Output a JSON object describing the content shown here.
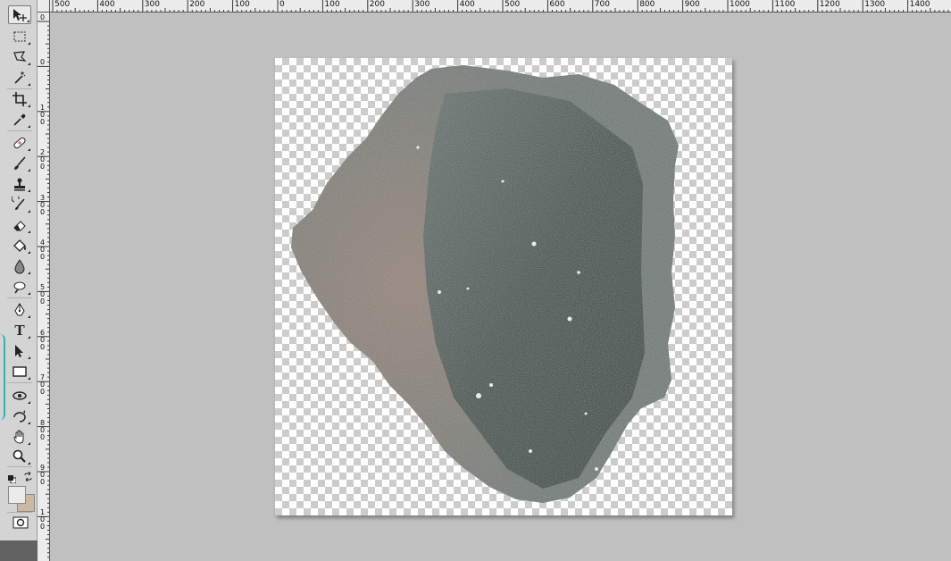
{
  "toolbox": {
    "tools": [
      {
        "id": "move",
        "icon": "move-tool-icon",
        "active": true
      },
      {
        "id": "marquee",
        "icon": "rect-marquee-icon"
      },
      {
        "id": "lasso",
        "icon": "polygonal-lasso-icon"
      },
      {
        "id": "magic-wand",
        "icon": "magic-wand-icon"
      },
      {
        "id": "crop",
        "icon": "crop-icon"
      },
      {
        "id": "eyedropper",
        "icon": "eyedropper-icon"
      },
      {
        "id": "healing",
        "icon": "healing-brush-icon"
      },
      {
        "id": "brush",
        "icon": "brush-icon"
      },
      {
        "id": "stamp",
        "icon": "clone-stamp-icon"
      },
      {
        "id": "history-brush",
        "icon": "history-brush-icon"
      },
      {
        "id": "eraser",
        "icon": "eraser-icon"
      },
      {
        "id": "bucket",
        "icon": "paint-bucket-icon"
      },
      {
        "id": "blur",
        "icon": "blur-drop-icon"
      },
      {
        "id": "dodge",
        "icon": "dodge-icon"
      },
      {
        "id": "pen",
        "icon": "pen-icon"
      },
      {
        "id": "type",
        "icon": "type-icon",
        "label": "T"
      },
      {
        "id": "path-select",
        "icon": "path-selection-icon"
      },
      {
        "id": "shape",
        "icon": "rectangle-shape-icon"
      },
      {
        "id": "3d-rotate",
        "icon": "3d-rotate-icon"
      },
      {
        "id": "3d-orbit",
        "icon": "3d-orbit-icon"
      },
      {
        "id": "hand",
        "icon": "hand-icon"
      },
      {
        "id": "zoom",
        "icon": "zoom-icon"
      }
    ],
    "colors": {
      "foreground": "#ebebeb",
      "background": "#cbb9a3",
      "accent": "#2fb3b0"
    }
  },
  "rulers": {
    "top": [
      "500",
      "400",
      "300",
      "200",
      "100",
      "0",
      "100",
      "200",
      "300",
      "400",
      "500",
      "600",
      "700",
      "800",
      "900",
      "1000",
      "1100",
      "1200",
      "1300",
      "1400",
      "1"
    ],
    "left": [
      "0",
      "0",
      "1 0 0",
      "2 0 0",
      "3 0 0",
      "4 0 0",
      "5 0 0",
      "6 0 0",
      "7 0 0",
      "8 0 0",
      "9 0 0",
      "1 0 0"
    ]
  },
  "document": {
    "background": "transparent-checkerboard",
    "content": "textured stone / puddle cutout",
    "colors": {
      "stone": "#6f7774",
      "dark": "#4e5653",
      "highlight": "#b48e80"
    }
  }
}
